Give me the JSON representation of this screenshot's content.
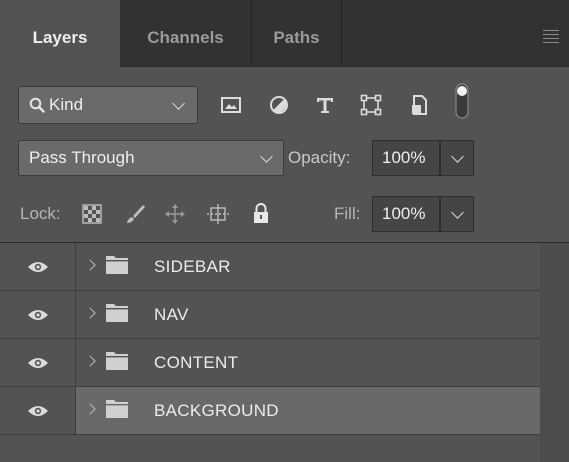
{
  "tabs": [
    {
      "label": "Layers",
      "active": true
    },
    {
      "label": "Channels",
      "active": false
    },
    {
      "label": "Paths",
      "active": false
    }
  ],
  "filter": {
    "kind_label": "Kind",
    "icons": [
      "image-icon",
      "adjustment-icon",
      "type-icon",
      "shape-icon",
      "smart-object-icon",
      "filter-toggle-icon"
    ]
  },
  "blend": {
    "mode": "Pass Through",
    "opacity_label": "Opacity:",
    "opacity_value": "100%"
  },
  "lock": {
    "label": "Lock:",
    "icons": [
      "lock-transparent-pixels-icon",
      "lock-image-pixels-icon",
      "lock-position-icon",
      "prevent-auto-nesting-icon",
      "lock-all-icon"
    ],
    "fill_label": "Fill:",
    "fill_value": "100%"
  },
  "layers": [
    {
      "name": "SIDEBAR",
      "visible": true,
      "type": "group",
      "selected": false
    },
    {
      "name": "NAV",
      "visible": true,
      "type": "group",
      "selected": false
    },
    {
      "name": "CONTENT",
      "visible": true,
      "type": "group",
      "selected": false
    },
    {
      "name": "BACKGROUND",
      "visible": true,
      "type": "group",
      "selected": true
    }
  ],
  "colors": {
    "panel_bg": "#535353",
    "tabbar_bg": "#323232",
    "selected_row": "#696969",
    "text": "#ececec"
  }
}
